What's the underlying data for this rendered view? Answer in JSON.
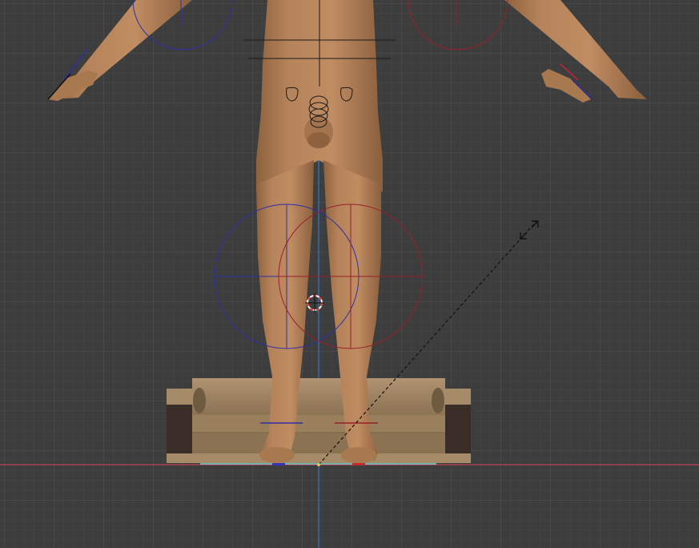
{
  "viewport": {
    "background": "#3d3d3d",
    "grid_minor": "#474747",
    "grid_major": "#4c4c4c",
    "x_axis_color": "#b8434f",
    "z_axis_color": "#3a78c8"
  },
  "scene": {
    "figure": {
      "skin": "#b5835a",
      "skin_shadow": "#8e623f"
    },
    "sofa": {
      "fabric": "#a58b67",
      "fabric_dark": "#7f6a4c",
      "legs": "#3a2c26"
    },
    "ik_controls": {
      "left_color": "#2d2fa8",
      "right_color": "#9a1f2a"
    },
    "floor_line": "#7fd3d4"
  },
  "cursor": {
    "icon": "3d-cursor-icon",
    "color_a": "#e03a3a",
    "color_b": "#ffffff"
  },
  "light": {
    "icon": "sun-light-direction-icon",
    "line_color": "#111111"
  }
}
